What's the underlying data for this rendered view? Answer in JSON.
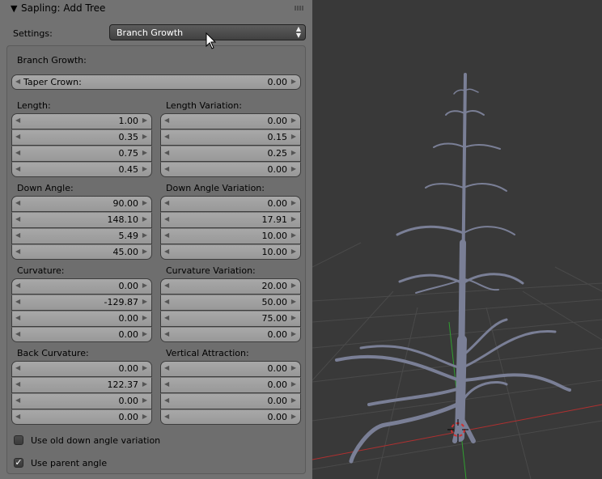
{
  "panel": {
    "title": "Sapling: Add Tree",
    "settings_label": "Settings:",
    "settings_value": "Branch Growth",
    "section_label": "Branch Growth:"
  },
  "taper": {
    "label": "Taper Crown:",
    "value": "0.00"
  },
  "groups": [
    {
      "left_label": "Length:",
      "right_label": "Length Variation:",
      "left": [
        "1.00",
        "0.35",
        "0.75",
        "0.45"
      ],
      "right": [
        "0.00",
        "0.15",
        "0.25",
        "0.00"
      ]
    },
    {
      "left_label": "Down Angle:",
      "right_label": "Down Angle Variation:",
      "left": [
        "90.00",
        "148.10",
        "5.49",
        "45.00"
      ],
      "right": [
        "0.00",
        "17.91",
        "10.00",
        "10.00"
      ]
    },
    {
      "left_label": "Curvature:",
      "right_label": "Curvature Variation:",
      "left": [
        "0.00",
        "-129.87",
        "0.00",
        "0.00"
      ],
      "right": [
        "20.00",
        "50.00",
        "75.00",
        "0.00"
      ]
    },
    {
      "left_label": "Back Curvature:",
      "right_label": "Vertical Attraction:",
      "left": [
        "0.00",
        "122.37",
        "0.00",
        "0.00"
      ],
      "right": [
        "0.00",
        "0.00",
        "0.00",
        "0.00"
      ]
    }
  ],
  "checkboxes": [
    {
      "label": "Use old down angle variation",
      "checked": false
    },
    {
      "label": "Use parent angle",
      "checked": true
    }
  ],
  "colors": {
    "panel_bg": "#727272",
    "viewport_bg": "#393939",
    "tree": "#7a7f96",
    "x_axis": "#c83232",
    "y_axis": "#3cb43c"
  }
}
